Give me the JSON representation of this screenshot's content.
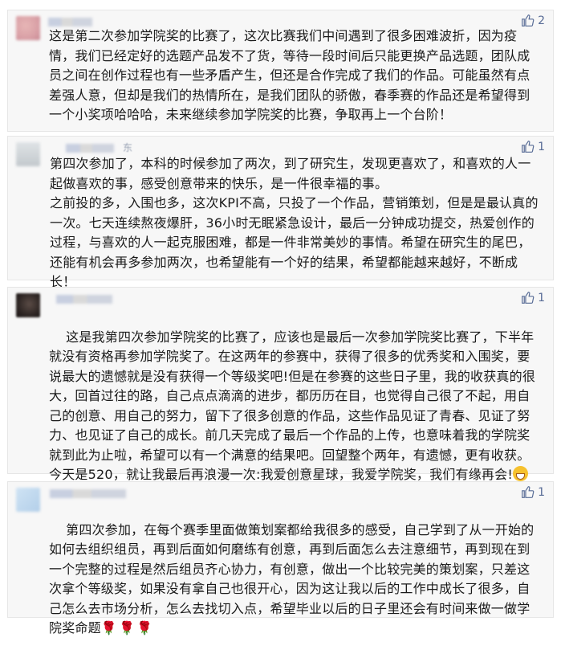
{
  "comments": [
    {
      "author": "",
      "likes": "2",
      "text": "这是第二次参加学院奖的比赛了，这次比赛我们中间遇到了很多困难波折，因为疫情，我们已经定好的选题产品发不了货，等待一段时间后只能更换产品选题，团队成员之间在创作过程也有一些矛盾产生，但还是合作完成了我们的作品。可能虽然有点差强人意，但却是我们的热情所在，是我们团队的骄傲，春季赛的作品还是希望得到一个小奖项哈哈哈，未来继续参加学院奖的比赛，争取再上一个台阶！"
    },
    {
      "author": "东",
      "likes": "1",
      "text": "第四次参加了，本科的时候参加了两次，到了研究生，发现更喜欢了，和喜欢的人一起做喜欢的事，感受创意带来的快乐，是一件很幸福的事。\n之前投的多，入围也多，这次KPI不高，只投了一个作品，营销策划，但是是最认真的一次。七天连续熬夜爆肝，36小时无眠紧急设计，最后一分钟成功提交，热爱创作的过程，与喜欢的人一起克服困难，都是一件非常美妙的事情。希望在研究生的尾巴，还能有机会再多参加两次，也希望能有一个好的结果，希望都能越来越好，不断成长！"
    },
    {
      "author": "",
      "likes": "1",
      "text": "这是我第四次参加学院奖的比赛了，应该也是最后一次参加学院奖比赛了，下半年就没有资格再参加学院奖了。在这两年的参赛中，获得了很多的优秀奖和入围奖，要说最大的遗憾就是没有获得一个等级奖吧!但是在参赛的这些日子里，我的收获真的很大，回首过往的路，自己点点滴滴的进步，都历历在目，也觉得自己很了不起，用自己的创意、用自己的努力，留下了很多创意的作品，这些作品见证了青春、见证了努力、也见证了自己的成长。前几天完成了最后一个作品的上传，也意味着我的学院奖就到此为止啦，希望可以有一个满意的结果吧。回望整个两年，有遗憾，更有收获。今天是520，就让我最后再浪漫一次:我爱创意星球，我爱学院奖，我们有缘再会!"
    },
    {
      "author": "",
      "likes": "1",
      "text": "第四次参加，在每个赛季里面做策划案都给我很多的感受，自己学到了从一开始的如何去组织组员，再到后面如何磨练有创意，再到后面怎么去注意细节，再到现在到一个完整的过程是然后组员齐心协力，有创意，做出一个比较完美的策划案，只差这次拿个等级奖，如果没有拿自己也很开心，因为这让我以后的工作中成长了很多，自己怎么去市场分析，怎么去找切入点，希望毕业以后的日子里还会有时间来做一做学院奖命题"
    }
  ],
  "icons": {
    "like": "thumbs-up-icon",
    "grin": "grinning-face-emoji",
    "rose": "rose-emoji"
  },
  "colors": {
    "like_accent": "#576b95",
    "card_bg": "#f7f7f7"
  }
}
